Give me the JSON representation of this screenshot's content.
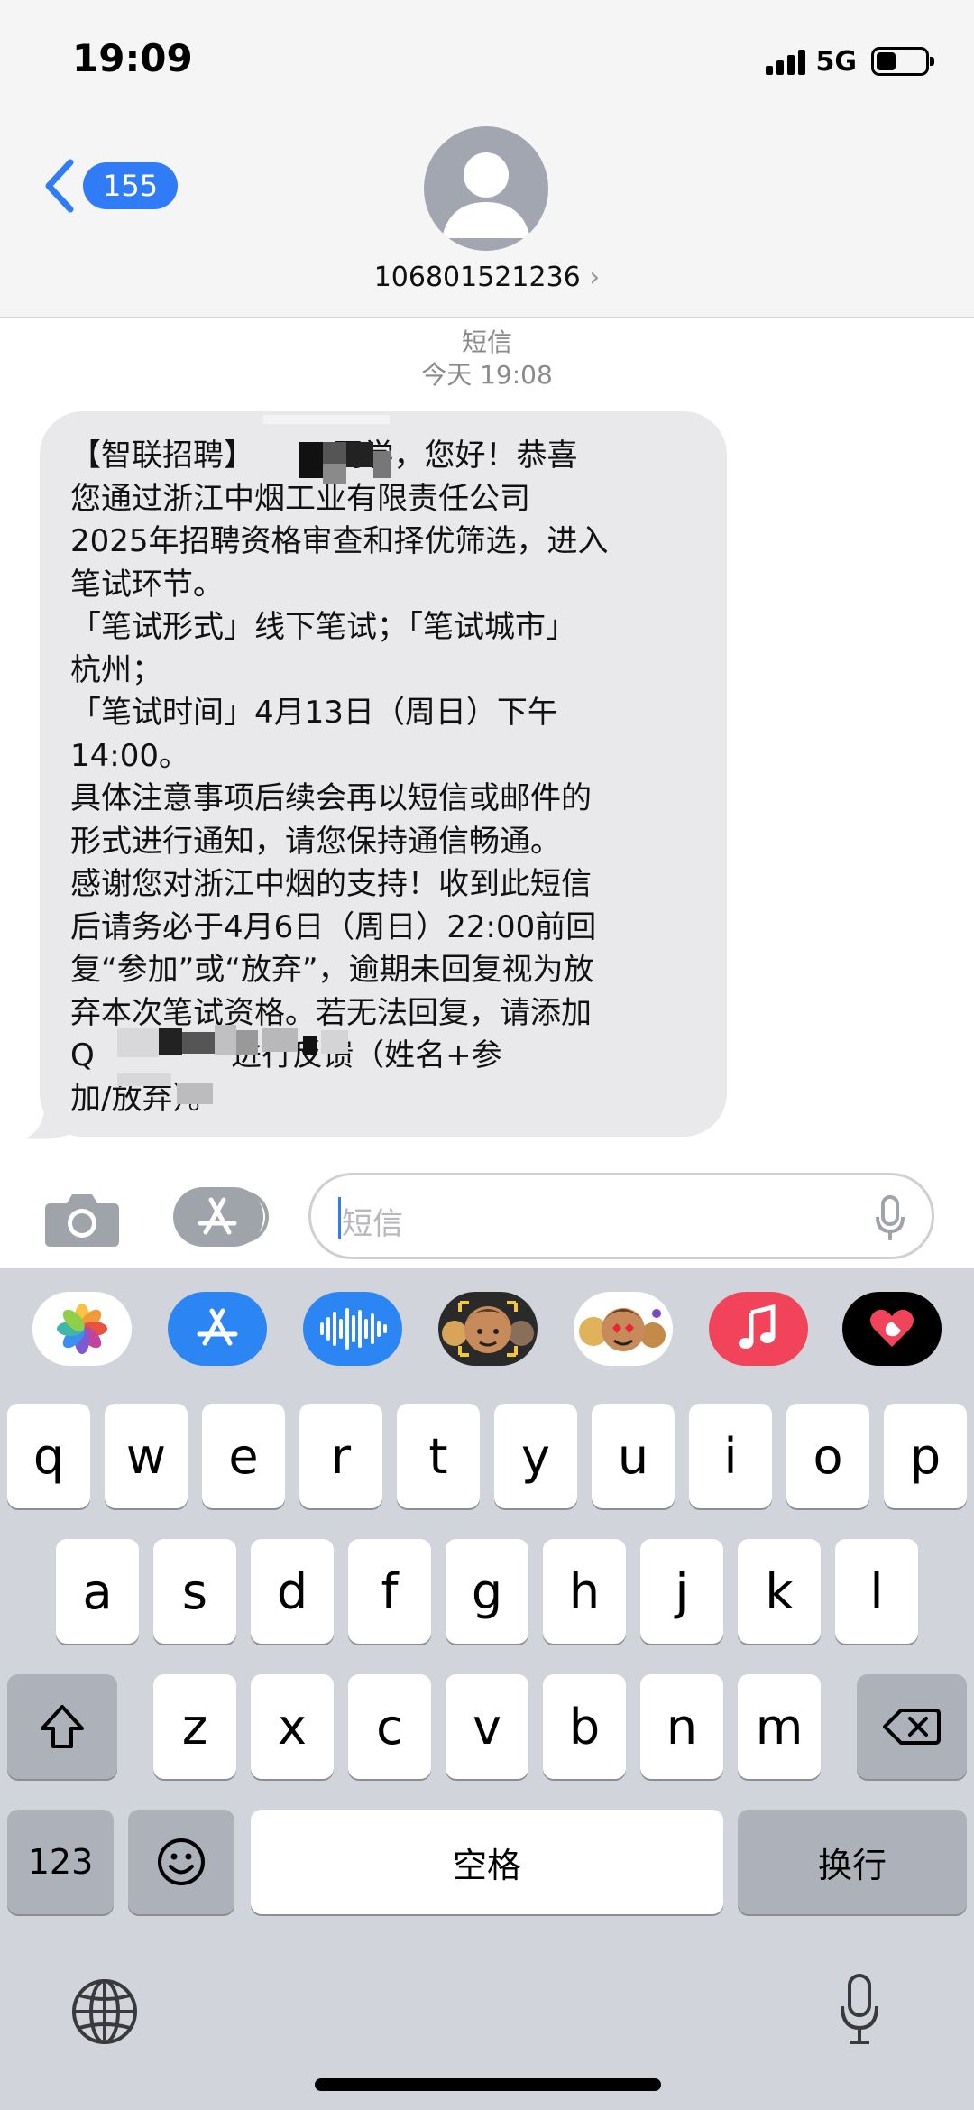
{
  "status_bar": {
    "time": "19:09",
    "network": "5G"
  },
  "header": {
    "back_count": "155",
    "contact_number": "106801521236",
    "number_chevron": "›"
  },
  "conversation": {
    "service_label": "短信",
    "timestamp": "今天 19:08",
    "message_lines": [
      "【智联招聘】        同学，您好！恭喜",
      "您通过浙江中烟工业有限责任公司",
      "2025年招聘资格审查和择优筛选，进入",
      "笔试环节。",
      "「笔试形式」线下笔试；「笔试城市」",
      "杭州；",
      "「笔试时间」4月13日（周日）下午",
      "14:00。",
      "具体注意事项后续会再以短信或邮件的",
      "形式进行通知，请您保持通信畅通。",
      "感谢您对浙江中烟的支持！收到此短信",
      "后请务必于4月6日（周日）22:00前回",
      "复“参加”或“放弃”，逾期未回复视为放",
      "弃本次笔试资格。若无法回复，请添加",
      "Q              进行反馈（姓名+参",
      "加/放弃）。"
    ]
  },
  "input": {
    "placeholder": "短信"
  },
  "keyboard": {
    "row1": [
      "q",
      "w",
      "e",
      "r",
      "t",
      "y",
      "u",
      "i",
      "o",
      "p"
    ],
    "row2": [
      "a",
      "s",
      "d",
      "f",
      "g",
      "h",
      "j",
      "k",
      "l"
    ],
    "row3": [
      "z",
      "x",
      "c",
      "v",
      "b",
      "n",
      "m"
    ],
    "numbers_key": "123",
    "space_key": "空格",
    "return_key": "换行",
    "app_strip": [
      "photos-app",
      "app-store-app",
      "audio-message-app",
      "memoji-app",
      "animoji-stickers-app",
      "music-app",
      "digital-touch-app"
    ]
  },
  "colors": {
    "accent_blue": "#2f7cf6",
    "bubble_gray": "#e9e9eb",
    "keyboard_bg": "#d1d4da"
  }
}
